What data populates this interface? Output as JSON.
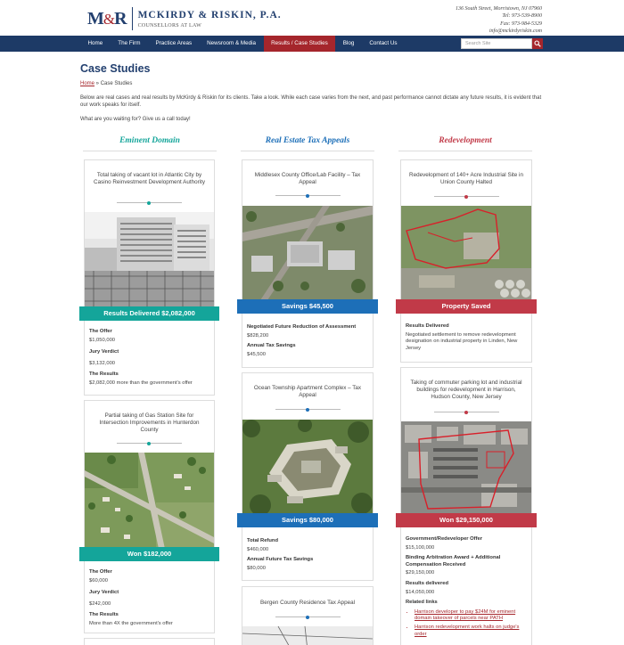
{
  "header": {
    "logo_mark_m": "M",
    "logo_mark_amp": "&",
    "logo_mark_r": "R",
    "firm_name": "MCKIRDY & RISKIN, P.A.",
    "tagline": "COUNSELLORS AT LAW",
    "address": "136 South Street, Morristown, NJ 07960",
    "tel": "Tel: 973-539-8900",
    "fax": "Fax: 973-984-5329",
    "email": "info@mckirdyriskin.com"
  },
  "nav": {
    "items": [
      "Home",
      "The Firm",
      "Practice Areas",
      "Newsroom & Media",
      "Results / Case Studies",
      "Blog",
      "Contact Us"
    ],
    "active_index": 4,
    "search_placeholder": "Search Site"
  },
  "main": {
    "title": "Case Studies",
    "breadcrumb_home": "Home",
    "breadcrumb_sep": " » ",
    "breadcrumb_current": "Case Studies",
    "intro": "Below are real cases and real results by McKirdy & Riskin for its clients.  Take a look.  While each case varies from the next, and past performance cannot dictate any future results, it is evident that our work speaks for itself.",
    "cta": "What are you waiting for? Give us a call today!"
  },
  "columns": [
    {
      "heading": "Eminent Domain",
      "color": "#14a59a"
    },
    {
      "heading": "Real Estate Tax Appeals",
      "color": "#1d6fb8"
    },
    {
      "heading": "Redevelopment",
      "color": "#c13a48"
    }
  ],
  "cards": {
    "ed1": {
      "title": "Total taking of vacant lot in Atlantic City by Casino Reinvestment Development Authority",
      "banner": "Results Delivered $2,082,000",
      "d1_label": "The Offer",
      "d1_value": "$1,050,000",
      "d2_label": "Jury Verdict",
      "d2_value": "$3,132,000",
      "d3_label": "The Results",
      "d3_value": "$2,082,000 more than the government's offer"
    },
    "ed2": {
      "title": "Partial taking of Gas Station Site for Intersection Improvements in Hunterdon County",
      "banner": "Won $182,000",
      "d1_label": "The Offer",
      "d1_value": "$60,000",
      "d2_label": "Jury Verdict",
      "d2_value": "$242,000",
      "d3_label": "The Results",
      "d3_value": "More than 4X the government's offer"
    },
    "rt1": {
      "title": "Middlesex County Office/Lab Facility – Tax Appeal",
      "banner": "Savings $45,500",
      "d1_label": "Negotiated Future Reduction of Assessment",
      "d1_value": "$828,200",
      "d2_label": "Annual Tax Savings",
      "d2_value": "$45,500"
    },
    "rt2": {
      "title": "Ocean Township Apartment Complex – Tax Appeal",
      "banner": "Savings $80,000",
      "d1_label": "Total Refund",
      "d1_value": "$460,000",
      "d2_label": "Annual Future Tax Savings",
      "d2_value": "$80,000"
    },
    "rt3": {
      "title": "Bergen County Residence Tax Appeal"
    },
    "rd1": {
      "title": "Redevelopment of 140+ Acre Industrial Site in Union County Halted",
      "banner": "Property Saved",
      "d1_label": "Results Delivered",
      "d1_value": "Negotiated settlement to remove redevelopment designation on industrial property in Linden, New Jersey"
    },
    "rd2": {
      "title": "Taking of commuter parking lot and industrial buildings for redevelopment in Harrison, Hudson County, New Jersey",
      "banner": "Won $29,150,000",
      "d1_label": "Government/Redeveloper Offer",
      "d1_value": "$15,100,000",
      "d2_label": "Binding Arbitration Award + Additional Compensation Received",
      "d2_value": "$29,150,000",
      "d3_label": "Results delivered",
      "d3_value": "$14,050,000",
      "links_label": "Related links",
      "links": [
        "Harrison developer to pay $24M for eminent domain takeover of parcels near PATH",
        "Harrison redevelopment work halts on judge's order"
      ]
    }
  }
}
